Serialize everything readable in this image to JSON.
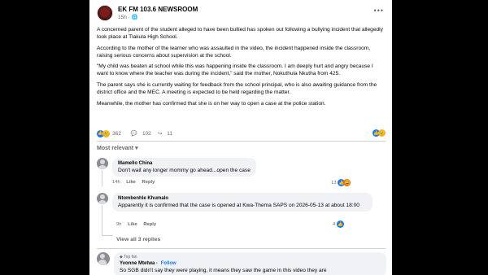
{
  "post": {
    "page_name": "EK FM 103.6 NEWSROOM",
    "time": "15h",
    "privacy_icon": "globe-icon",
    "paragraphs": [
      "A concerned parent of the student alleged  to have been bullied has spoken out following a bullying incident that allegedly took place at Tlakula High School.",
      "According to the mother of the learner who was assaulted in the video, the incident happened inside the classroom, raising serious concerns about supervision at the school.",
      "“My child was beaten at school while this was happening inside the classroom. I am deeply hurt and angry because I want to know where the teacher was during the incident,” said the mother, Nokuthula Nkutha from  425.",
      "The parent says she is currently waiting for feedback from the school principal, who is also awaiting guidance from the district office and the MEC. A meeting is expected to be held regarding the matter.",
      "Meanwhile, the mother has confirmed that she is on her way to open a case at the police station."
    ],
    "reaction_count": "362",
    "comment_count": "102",
    "share_count": "11"
  },
  "comments_filter": {
    "label": "Most relevant"
  },
  "comments": [
    {
      "name": "Mamello China",
      "text": "Don't wait any longer mommy go ahead...open the case",
      "time": "14h",
      "like": "Like",
      "reply": "Reply",
      "reactions": "13"
    },
    {
      "name": "Ntombenhle Khumalo",
      "text": "Apparently it is confirmed that the case is opened at Kwa-Thema SAPS on 2026-05-13 at about 18:00",
      "time": "9h",
      "like": "Like",
      "reply": "Reply",
      "reactions": "4"
    },
    {
      "badge": "Top fan",
      "name": "Yvonne Mtetwa",
      "follow": "Follow",
      "text": "So SGB didn't say they were playing, it means they saw the game in this video they are"
    }
  ],
  "view_replies": "View all 3 replies",
  "colors": {
    "brand": "#1877f2",
    "muted": "#65676b",
    "bubble": "#f0f2f5"
  }
}
